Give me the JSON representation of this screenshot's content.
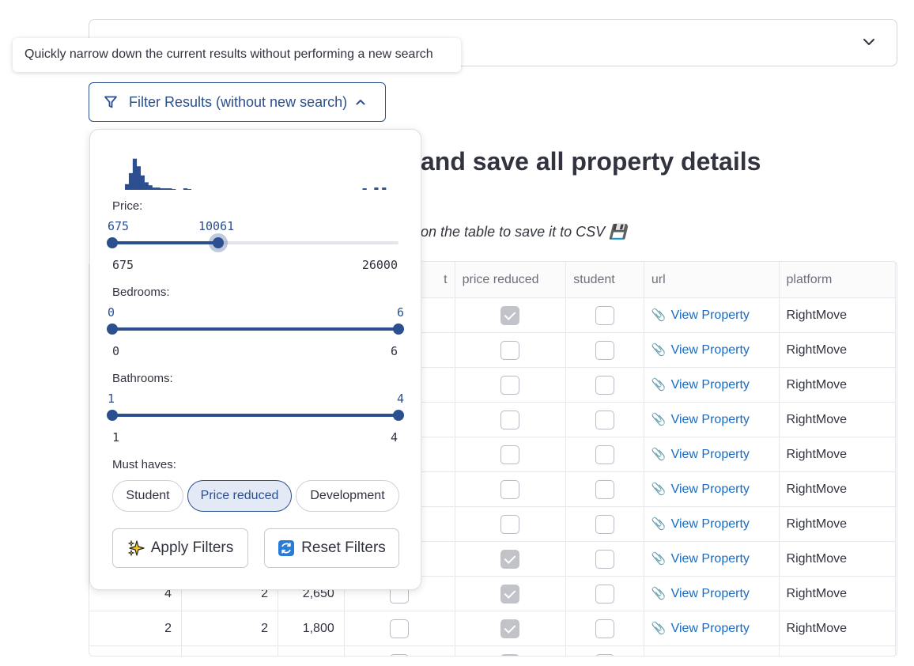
{
  "tooltip": {
    "text": "Quickly narrow down the current results without performing a new search"
  },
  "filter_button": {
    "label": "Filter Results (without new search)"
  },
  "heading": {
    "text": "and save all property details"
  },
  "caption": {
    "text": "on the table to save it to CSV 💾"
  },
  "filters": {
    "price": {
      "label": "Price:",
      "low": "675",
      "high": "10061",
      "min": "675",
      "max": "26000",
      "low_value": 675,
      "high_value": 10061,
      "range": [
        675,
        26000
      ]
    },
    "bedrooms": {
      "label": "Bedrooms:",
      "low": "0",
      "high": "6",
      "min": "0",
      "max": "6",
      "low_value": 0,
      "high_value": 6,
      "range": [
        0,
        6
      ]
    },
    "bathrooms": {
      "label": "Bathrooms:",
      "low": "1",
      "high": "4",
      "min": "1",
      "max": "4",
      "low_value": 1,
      "high_value": 4,
      "range": [
        1,
        4
      ]
    },
    "must_haves_label": "Must haves:",
    "must_haves": [
      {
        "label": "Student",
        "selected": false
      },
      {
        "label": "Price reduced",
        "selected": true
      },
      {
        "label": "Development",
        "selected": false
      }
    ],
    "apply_label": "Apply Filters",
    "reset_label": "Reset Filters",
    "histogram": [
      0.15,
      0.44,
      0.82,
      0.62,
      0.38,
      0.2,
      0.12,
      0.06,
      0.06,
      0.04,
      0.04,
      0.04,
      0.02,
      0,
      0,
      0.04,
      0.02,
      0,
      0,
      0,
      0,
      0,
      0,
      0,
      0,
      0,
      0,
      0,
      0,
      0,
      0,
      0,
      0,
      0,
      0,
      0,
      0,
      0,
      0,
      0,
      0,
      0,
      0,
      0,
      0,
      0,
      0,
      0,
      0,
      0,
      0,
      0,
      0,
      0,
      0,
      0,
      0,
      0,
      0,
      0,
      0,
      0.04,
      0,
      0,
      0.06,
      0,
      0.06,
      0
    ],
    "accent_color": "#2b4f8f"
  },
  "table": {
    "headers": [
      "t",
      "price reduced",
      "student",
      "url",
      "platform"
    ],
    "link_text": "View Property",
    "rows": [
      {
        "beds": "",
        "baths": "",
        "price": "",
        "dev": false,
        "price_reduced": true,
        "student": false,
        "platform": "RightMove"
      },
      {
        "beds": "",
        "baths": "",
        "price": "",
        "dev": false,
        "price_reduced": false,
        "student": false,
        "platform": "RightMove"
      },
      {
        "beds": "",
        "baths": "",
        "price": "",
        "dev": false,
        "price_reduced": false,
        "student": false,
        "platform": "RightMove"
      },
      {
        "beds": "",
        "baths": "",
        "price": "",
        "dev": false,
        "price_reduced": false,
        "student": false,
        "platform": "RightMove"
      },
      {
        "beds": "",
        "baths": "",
        "price": "",
        "dev": false,
        "price_reduced": false,
        "student": false,
        "platform": "RightMove"
      },
      {
        "beds": "",
        "baths": "",
        "price": "",
        "dev": false,
        "price_reduced": false,
        "student": false,
        "platform": "RightMove"
      },
      {
        "beds": "",
        "baths": "",
        "price": "",
        "dev": false,
        "price_reduced": false,
        "student": false,
        "platform": "RightMove"
      },
      {
        "beds": "",
        "baths": "",
        "price": "",
        "dev": false,
        "price_reduced": true,
        "student": false,
        "platform": "RightMove"
      },
      {
        "beds": "4",
        "baths": "2",
        "price": "2,650",
        "dev": false,
        "price_reduced": true,
        "student": false,
        "platform": "RightMove"
      },
      {
        "beds": "2",
        "baths": "2",
        "price": "1,800",
        "dev": false,
        "price_reduced": true,
        "student": false,
        "platform": "RightMove"
      },
      {
        "beds": "",
        "baths": "",
        "price": "",
        "dev": false,
        "price_reduced": true,
        "student": false,
        "platform": "RightMove"
      }
    ]
  }
}
